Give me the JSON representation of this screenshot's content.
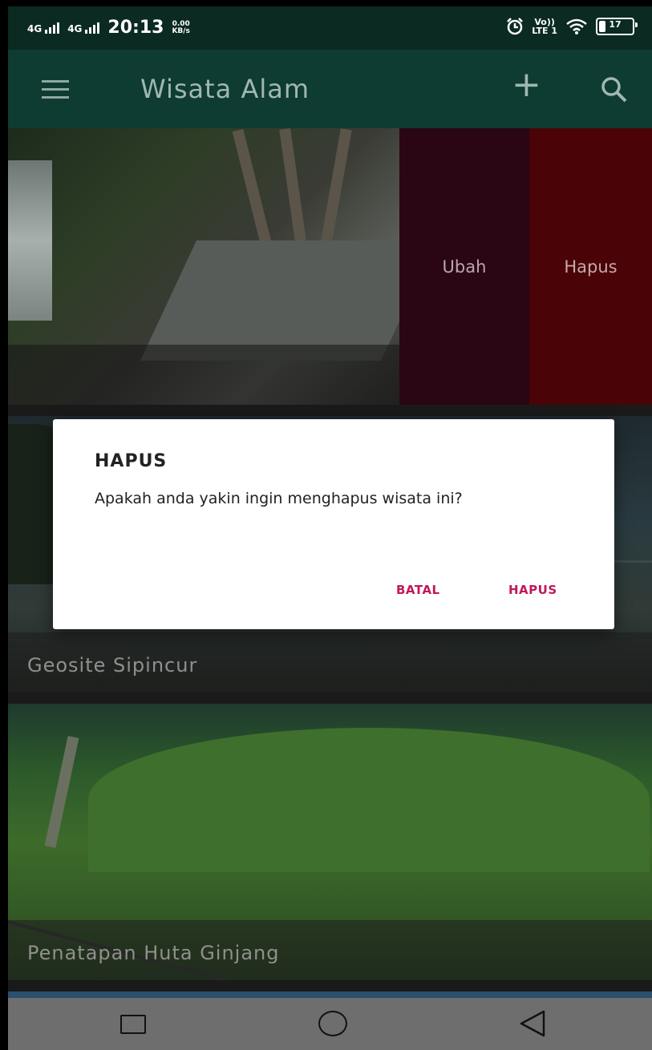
{
  "status_bar": {
    "net1": "4G",
    "net2": "4G",
    "time": "20:13",
    "speed_value": "0.00",
    "speed_unit": "KB/s",
    "volte": "Vo))",
    "lte": "LTE 1",
    "battery": "17"
  },
  "app_bar": {
    "title": "Wisata Alam",
    "menu_icon": "hamburger-menu-icon",
    "add_icon": "plus-icon",
    "search_icon": "search-icon"
  },
  "cards": [
    {
      "label": "",
      "swipe_actions": {
        "edit_label": "Ubah",
        "delete_label": "Hapus"
      }
    },
    {
      "label": "Geosite Sipincur"
    },
    {
      "label": "Penatapan Huta Ginjang"
    }
  ],
  "dialog": {
    "title": "HAPUS",
    "message": "Apakah anda yakin ingin menghapus wisata ini?",
    "cancel_label": "BATAL",
    "confirm_label": "HAPUS"
  },
  "colors": {
    "app_bar": "#0e3b32",
    "status_bar": "#0a2a22",
    "edit_action": "#2a0614",
    "delete_action": "#4a0306",
    "dialog_button": "#c1185b"
  },
  "nav_bar": {
    "recents_icon": "square-icon",
    "home_icon": "circle-icon",
    "back_icon": "triangle-back-icon"
  }
}
